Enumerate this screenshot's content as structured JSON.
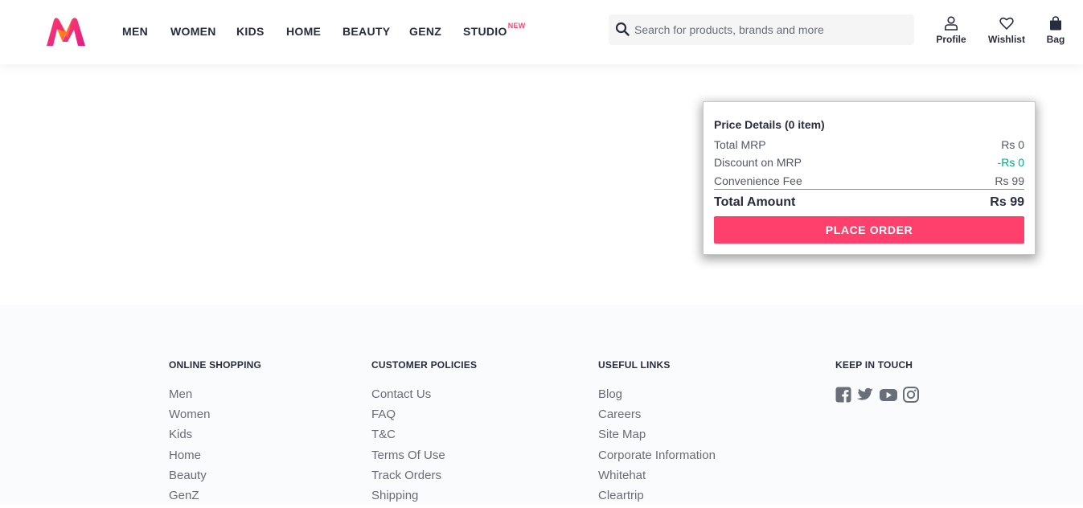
{
  "header": {
    "logo": "myntra-logo",
    "nav": [
      {
        "label": "MEN"
      },
      {
        "label": "WOMEN"
      },
      {
        "label": "KIDS"
      },
      {
        "label": "HOME"
      },
      {
        "label": "BEAUTY"
      },
      {
        "label": "GENZ"
      },
      {
        "label": "STUDIO",
        "badge": "NEW"
      }
    ],
    "search": {
      "placeholder": "Search for products, brands and more",
      "icon": "search-icon"
    },
    "actions": [
      {
        "label": "Profile",
        "icon": "user-icon"
      },
      {
        "label": "Wishlist",
        "icon": "heart-icon"
      },
      {
        "label": "Bag",
        "icon": "bag-icon"
      }
    ]
  },
  "price_details": {
    "title": "Price Details (0 item)",
    "rows": [
      {
        "label": "Total MRP",
        "value": "Rs 0"
      },
      {
        "label": "Discount on MRP",
        "value": "-Rs 0"
      },
      {
        "label": "Convenience Fee",
        "value": "Rs 99"
      }
    ],
    "total_label": "Total Amount",
    "total_value": "Rs 99",
    "button": "PLACE ORDER"
  },
  "footer": {
    "columns": [
      {
        "title": "ONLINE SHOPPING",
        "links": [
          "Men",
          "Women",
          "Kids",
          "Home",
          "Beauty",
          "GenZ"
        ]
      },
      {
        "title": "CUSTOMER POLICIES",
        "links": [
          "Contact Us",
          "FAQ",
          "T&C",
          "Terms Of Use",
          "Track Orders",
          "Shipping"
        ]
      },
      {
        "title": "USEFUL LINKS",
        "links": [
          "Blog",
          "Careers",
          "Site Map",
          "Corporate Information",
          "Whitehat",
          "Cleartrip"
        ]
      },
      {
        "title": "KEEP IN TOUCH",
        "social": [
          "facebook-icon",
          "twitter-icon",
          "youtube-icon",
          "instagram-icon"
        ]
      }
    ]
  },
  "colors": {
    "accent": "#ff3f6c",
    "discount": "#03a685",
    "text": "#282c3f",
    "muted": "#696b79"
  }
}
